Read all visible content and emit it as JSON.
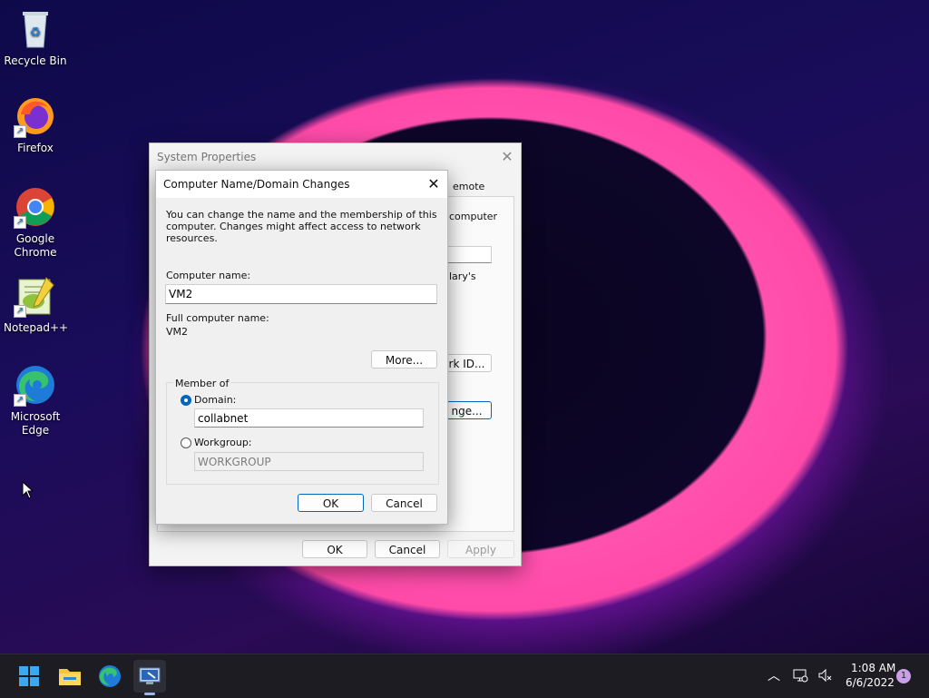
{
  "desktop": {
    "icons": [
      {
        "label": "Recycle Bin"
      },
      {
        "label": "Firefox"
      },
      {
        "label": "Google Chrome"
      },
      {
        "label": "Notepad++"
      },
      {
        "label": "Microsoft Edge"
      }
    ]
  },
  "system_properties": {
    "title": "System Properties",
    "partial_tab": "emote",
    "partial_text_1": "computer",
    "partial_text_2": "lary's",
    "partial_btn_network": "rk ID...",
    "partial_btn_change": "nge...",
    "ok_label": "OK",
    "cancel_label": "Cancel",
    "apply_label": "Apply"
  },
  "domain_dialog": {
    "title": "Computer Name/Domain Changes",
    "description": "You can change the name and the membership of this computer. Changes might affect access to network resources.",
    "computer_name_label": "Computer name:",
    "computer_name_value": "VM2",
    "full_name_label": "Full computer name:",
    "full_name_value": "VM2",
    "more_label": "More...",
    "member_of_label": "Member of",
    "domain_label": "Domain:",
    "domain_value": "collabnet",
    "workgroup_label": "Workgroup:",
    "workgroup_value": "WORKGROUP",
    "ok_label": "OK",
    "cancel_label": "Cancel",
    "selected_option": "domain"
  },
  "taskbar": {
    "time": "1:08 AM",
    "date": "6/6/2022",
    "notification_count": "1"
  },
  "colors": {
    "accent": "#0067c0",
    "taskbar": "#1c1c22"
  }
}
